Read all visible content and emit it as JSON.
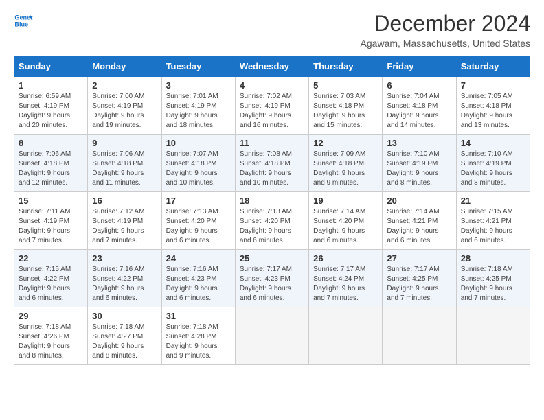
{
  "header": {
    "logo": {
      "line1": "General",
      "line2": "Blue",
      "icon_color": "#1a73c7"
    },
    "title": "December 2024",
    "subtitle": "Agawam, Massachusetts, United States"
  },
  "calendar": {
    "weekdays": [
      "Sunday",
      "Monday",
      "Tuesday",
      "Wednesday",
      "Thursday",
      "Friday",
      "Saturday"
    ],
    "weeks": [
      [
        {
          "day": "1",
          "sunrise": "6:59 AM",
          "sunset": "4:19 PM",
          "daylight": "9 hours and 20 minutes."
        },
        {
          "day": "2",
          "sunrise": "7:00 AM",
          "sunset": "4:19 PM",
          "daylight": "9 hours and 19 minutes."
        },
        {
          "day": "3",
          "sunrise": "7:01 AM",
          "sunset": "4:19 PM",
          "daylight": "9 hours and 18 minutes."
        },
        {
          "day": "4",
          "sunrise": "7:02 AM",
          "sunset": "4:19 PM",
          "daylight": "9 hours and 16 minutes."
        },
        {
          "day": "5",
          "sunrise": "7:03 AM",
          "sunset": "4:18 PM",
          "daylight": "9 hours and 15 minutes."
        },
        {
          "day": "6",
          "sunrise": "7:04 AM",
          "sunset": "4:18 PM",
          "daylight": "9 hours and 14 minutes."
        },
        {
          "day": "7",
          "sunrise": "7:05 AM",
          "sunset": "4:18 PM",
          "daylight": "9 hours and 13 minutes."
        }
      ],
      [
        {
          "day": "8",
          "sunrise": "7:06 AM",
          "sunset": "4:18 PM",
          "daylight": "9 hours and 12 minutes."
        },
        {
          "day": "9",
          "sunrise": "7:06 AM",
          "sunset": "4:18 PM",
          "daylight": "9 hours and 11 minutes."
        },
        {
          "day": "10",
          "sunrise": "7:07 AM",
          "sunset": "4:18 PM",
          "daylight": "9 hours and 10 minutes."
        },
        {
          "day": "11",
          "sunrise": "7:08 AM",
          "sunset": "4:18 PM",
          "daylight": "9 hours and 10 minutes."
        },
        {
          "day": "12",
          "sunrise": "7:09 AM",
          "sunset": "4:18 PM",
          "daylight": "9 hours and 9 minutes."
        },
        {
          "day": "13",
          "sunrise": "7:10 AM",
          "sunset": "4:19 PM",
          "daylight": "9 hours and 8 minutes."
        },
        {
          "day": "14",
          "sunrise": "7:10 AM",
          "sunset": "4:19 PM",
          "daylight": "9 hours and 8 minutes."
        }
      ],
      [
        {
          "day": "15",
          "sunrise": "7:11 AM",
          "sunset": "4:19 PM",
          "daylight": "9 hours and 7 minutes."
        },
        {
          "day": "16",
          "sunrise": "7:12 AM",
          "sunset": "4:19 PM",
          "daylight": "9 hours and 7 minutes."
        },
        {
          "day": "17",
          "sunrise": "7:13 AM",
          "sunset": "4:20 PM",
          "daylight": "9 hours and 6 minutes."
        },
        {
          "day": "18",
          "sunrise": "7:13 AM",
          "sunset": "4:20 PM",
          "daylight": "9 hours and 6 minutes."
        },
        {
          "day": "19",
          "sunrise": "7:14 AM",
          "sunset": "4:20 PM",
          "daylight": "9 hours and 6 minutes."
        },
        {
          "day": "20",
          "sunrise": "7:14 AM",
          "sunset": "4:21 PM",
          "daylight": "9 hours and 6 minutes."
        },
        {
          "day": "21",
          "sunrise": "7:15 AM",
          "sunset": "4:21 PM",
          "daylight": "9 hours and 6 minutes."
        }
      ],
      [
        {
          "day": "22",
          "sunrise": "7:15 AM",
          "sunset": "4:22 PM",
          "daylight": "9 hours and 6 minutes."
        },
        {
          "day": "23",
          "sunrise": "7:16 AM",
          "sunset": "4:22 PM",
          "daylight": "9 hours and 6 minutes."
        },
        {
          "day": "24",
          "sunrise": "7:16 AM",
          "sunset": "4:23 PM",
          "daylight": "9 hours and 6 minutes."
        },
        {
          "day": "25",
          "sunrise": "7:17 AM",
          "sunset": "4:23 PM",
          "daylight": "9 hours and 6 minutes."
        },
        {
          "day": "26",
          "sunrise": "7:17 AM",
          "sunset": "4:24 PM",
          "daylight": "9 hours and 7 minutes."
        },
        {
          "day": "27",
          "sunrise": "7:17 AM",
          "sunset": "4:25 PM",
          "daylight": "9 hours and 7 minutes."
        },
        {
          "day": "28",
          "sunrise": "7:18 AM",
          "sunset": "4:25 PM",
          "daylight": "9 hours and 7 minutes."
        }
      ],
      [
        {
          "day": "29",
          "sunrise": "7:18 AM",
          "sunset": "4:26 PM",
          "daylight": "9 hours and 8 minutes."
        },
        {
          "day": "30",
          "sunrise": "7:18 AM",
          "sunset": "4:27 PM",
          "daylight": "9 hours and 8 minutes."
        },
        {
          "day": "31",
          "sunrise": "7:18 AM",
          "sunset": "4:28 PM",
          "daylight": "9 hours and 9 minutes."
        },
        null,
        null,
        null,
        null
      ]
    ]
  }
}
